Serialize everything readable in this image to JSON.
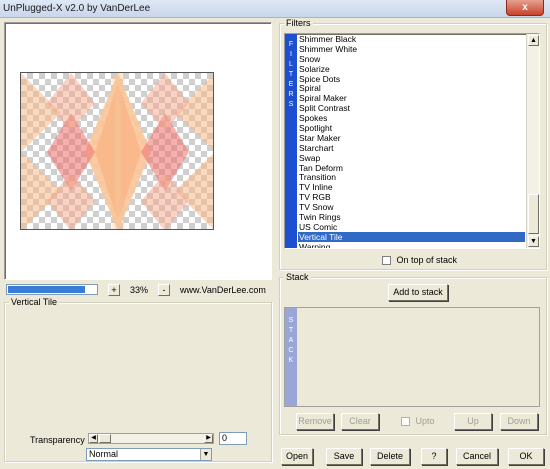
{
  "window": {
    "title": "UnPlugged-X v2.0 by VanDerLee",
    "close_label": "x"
  },
  "preview": {
    "zoom": "33%",
    "zoom_plus": "+",
    "zoom_minus": "-",
    "website": "www.VanDerLee.com",
    "progress_fraction": 0.88
  },
  "filters": {
    "label": "Filters",
    "strip_text": "F I L T E R S",
    "items": [
      "Shimmer Black",
      "Shimmer White",
      "Snow",
      "Solarize",
      "Spice Dots",
      "Spiral",
      "Spiral Maker",
      "Split Contrast",
      "Spokes",
      "Spotlight",
      "Star Maker",
      "Starchart",
      "Swap",
      "Tan Deform",
      "Transition",
      "TV Inline",
      "TV RGB",
      "TV Snow",
      "Twin Rings",
      "US Comic",
      "Vertical Tile",
      "Warping"
    ],
    "selected_index": 20,
    "on_top_of_stack_label": "On top of stack"
  },
  "settings": {
    "label": "Vertical Tile",
    "transparency_label": "Transparency",
    "transparency_value": "0",
    "blend_mode": "Normal"
  },
  "stack": {
    "label": "Stack",
    "strip_text": "S T A C K",
    "add_button": "Add to stack",
    "remove_button": "Remove",
    "clear_button": "Clear",
    "upto_label": "Upto",
    "up_button": "Up",
    "down_button": "Down"
  },
  "footer": {
    "open": "Open",
    "save": "Save",
    "delete": "Delete",
    "help": "?",
    "cancel": "Cancel",
    "ok": "OK"
  },
  "colors": {
    "accent": "#316ac5",
    "filter_strip": "#1f4fd1",
    "preview_tile": "#f5b98a",
    "preview_tile_edge": "#ef6f6b"
  }
}
